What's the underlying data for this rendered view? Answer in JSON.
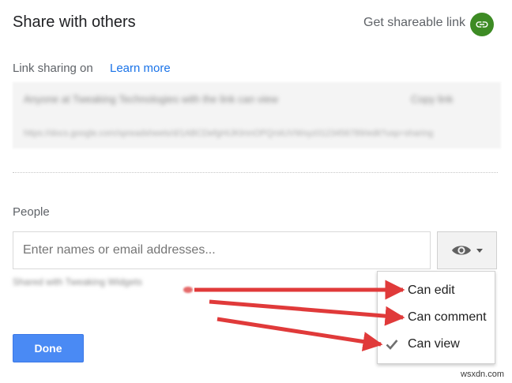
{
  "dialog": {
    "title": "Share with others",
    "get_link_label": "Get shareable link",
    "link_icon": "link-icon"
  },
  "link_sharing": {
    "label": "Link sharing on",
    "learn_more": "Learn more",
    "blurred_option": "Anyone at Tweaking Technologies with the link can view",
    "blurred_copy": "Copy link",
    "blurred_url": "https://docs.google.com/spreadsheets/d/1ABCDefgHIJKlmnOPQrstUVWxyz0123456789/edit?usp=sharing"
  },
  "people": {
    "label": "People",
    "input_placeholder": "Enter names or email addresses...",
    "permission_icon": "eye-icon",
    "shared_with": "Shared with Tweaking Widgets"
  },
  "permission_menu": {
    "items": [
      {
        "label": "Can edit",
        "checked": false
      },
      {
        "label": "Can comment",
        "checked": false
      },
      {
        "label": "Can view",
        "checked": true
      }
    ]
  },
  "done_button": "Done",
  "watermark": "wsxdn.com",
  "colors": {
    "accent_blue": "#4a8af4",
    "link_blue": "#1a73e8",
    "link_icon_green": "#3d8b24",
    "arrow_red": "#e03a3a"
  }
}
